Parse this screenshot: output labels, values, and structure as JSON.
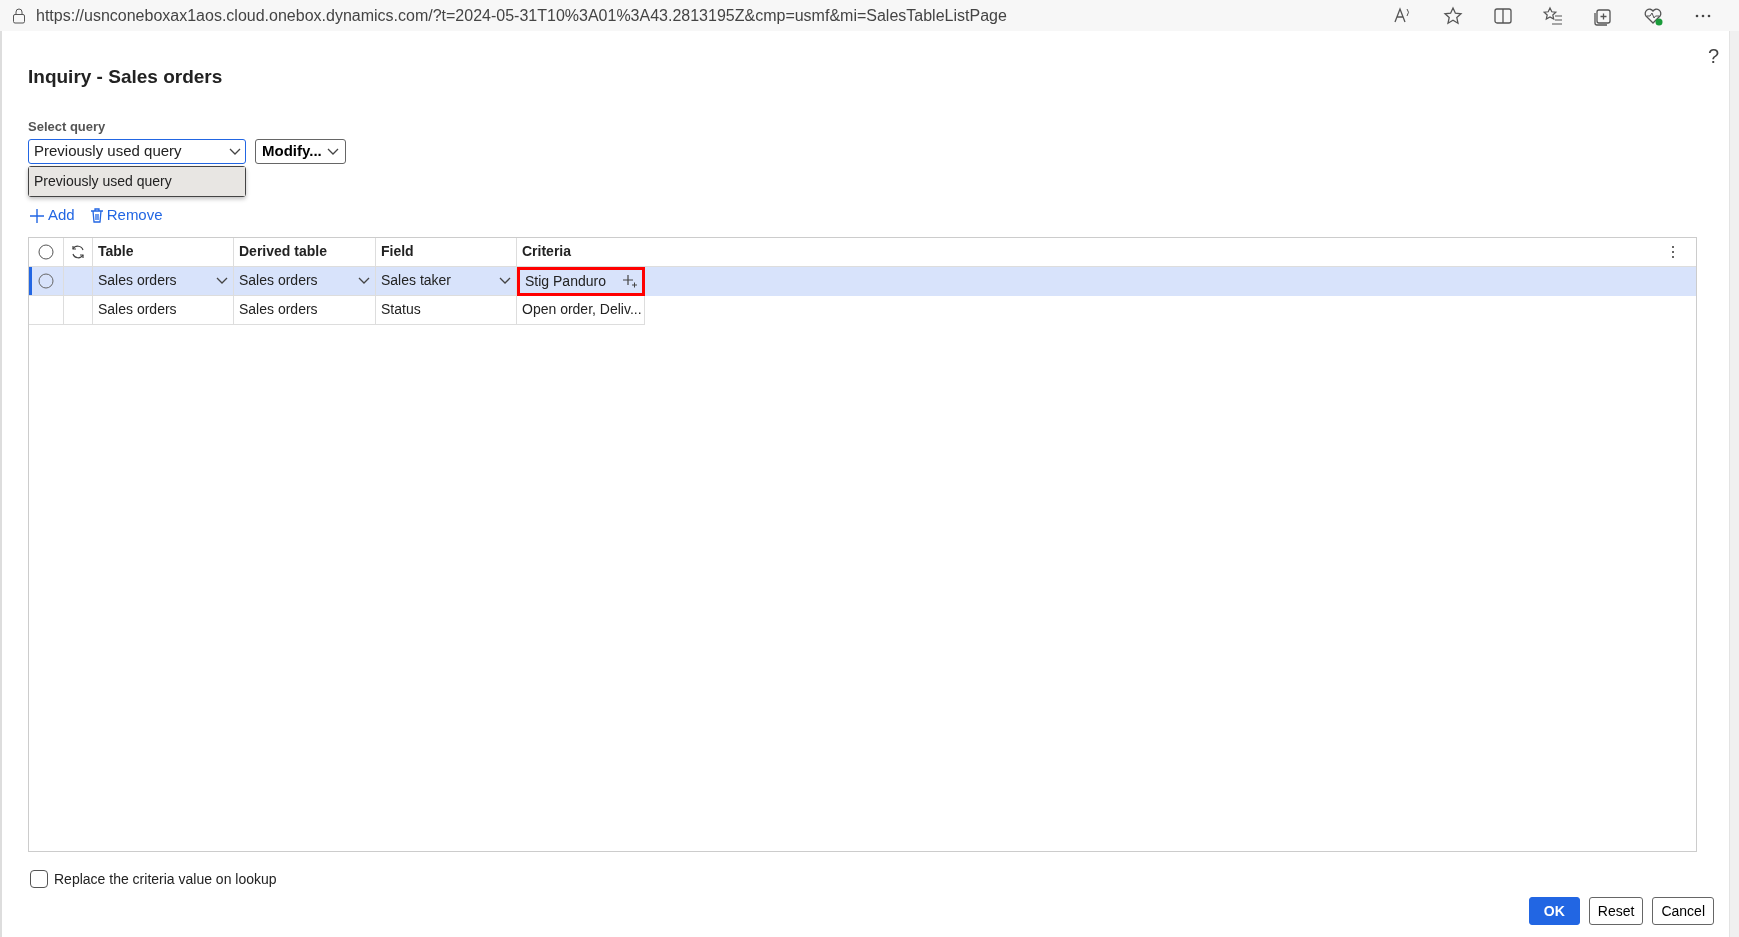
{
  "browser": {
    "url": "https://usnconeboxax1aos.cloud.onebox.dynamics.com/?t=2024-05-31T10%3A01%3A43.2813195Z&cmp=usmf&mi=SalesTableListPage"
  },
  "dialog": {
    "title": "Inquiry - Sales orders",
    "help": "?"
  },
  "select_query": {
    "label": "Select query",
    "value": "Previously used query",
    "expanded": true,
    "options": [
      {
        "label": "Previously used query",
        "selected": true
      }
    ]
  },
  "modify_button": "Modify...",
  "actions": [
    {
      "kind": "add",
      "label": "Add"
    },
    {
      "kind": "remove",
      "label": "Remove"
    }
  ],
  "grid": {
    "select_all": {
      "checked": false
    },
    "columns": [
      "Table",
      "Derived table",
      "Field",
      "Criteria"
    ],
    "rows": [
      {
        "selected": true,
        "editable": true,
        "annotated": true,
        "cells": [
          "Sales orders",
          "Sales orders",
          "Sales taker",
          "Stig Panduro"
        ]
      },
      {
        "selected": false,
        "editable": false,
        "annotated": false,
        "cells": [
          "Sales orders",
          "Sales orders",
          "Status",
          "Open order, Deliv..."
        ]
      }
    ]
  },
  "replace_lookup": {
    "label": "Replace the criteria value on lookup",
    "checked": false
  },
  "buttons": [
    {
      "label": "OK",
      "kind": "primary"
    },
    {
      "label": "Reset",
      "kind": "default"
    },
    {
      "label": "Cancel",
      "kind": "default"
    }
  ]
}
